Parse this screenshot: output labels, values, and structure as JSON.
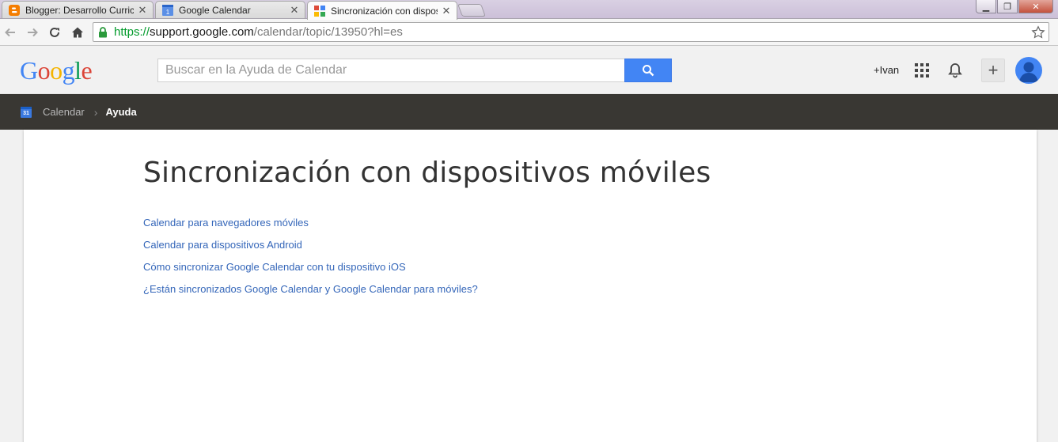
{
  "browser": {
    "tabs": [
      {
        "title": "Blogger: Desarrollo Curricu",
        "icon": "blogger-icon",
        "active": false
      },
      {
        "title": "Google Calendar",
        "icon": "calendar-icon",
        "active": false
      },
      {
        "title": "Sincronización con dispos",
        "icon": "google-support-icon",
        "active": true
      }
    ],
    "address": {
      "scheme": "https://",
      "host": "support.google.com",
      "path": "/calendar/topic/13950?hl=es"
    }
  },
  "header": {
    "logo": "Google",
    "search_placeholder": "Buscar en la Ayuda de Calendar",
    "user_link": "+Ivan"
  },
  "breadcrumb": {
    "product": "Calendar",
    "current": "Ayuda",
    "icon_text": "31"
  },
  "main": {
    "title": "Sincronización con dispositivos móviles",
    "links": [
      "Calendar para navegadores móviles",
      "Calendar para dispositivos Android",
      "Cómo sincronizar Google Calendar con tu dispositivo iOS",
      "¿Están sincronizados Google Calendar y Google Calendar para móviles?"
    ]
  },
  "colors": {
    "link": "#3466b9",
    "search_button": "#4285f4",
    "breadcrumb_bar": "#393733",
    "url_scheme": "#009a2a"
  }
}
